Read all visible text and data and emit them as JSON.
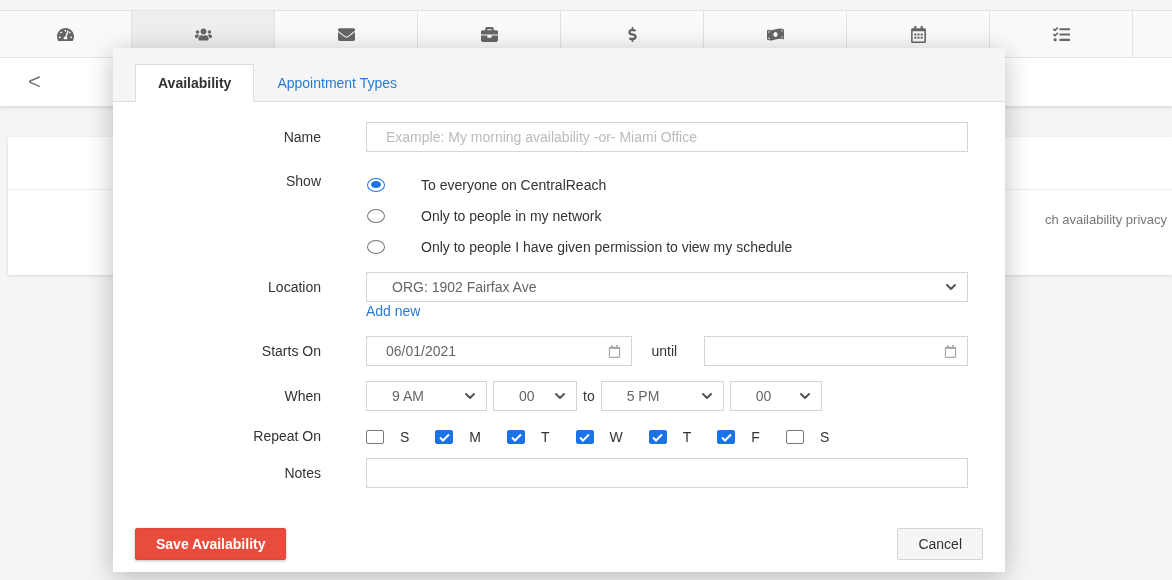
{
  "nav": {
    "items": [
      {
        "selected": false
      },
      {
        "selected": true
      },
      {
        "selected": false
      },
      {
        "selected": false
      },
      {
        "selected": false
      },
      {
        "selected": false
      },
      {
        "selected": false
      },
      {
        "selected": false
      }
    ]
  },
  "back_button": "<",
  "background_card": {
    "text": "ch availability privacy"
  },
  "dialog": {
    "tabs": [
      {
        "label": "Availability",
        "selected": true
      },
      {
        "label": "Appointment Types",
        "selected": false
      }
    ],
    "name": {
      "label": "Name",
      "placeholder": "Example: My morning availability -or- Miami Office"
    },
    "show": {
      "label": "Show",
      "options": [
        {
          "label": "To everyone on CentralReach",
          "selected": true
        },
        {
          "label": "Only to people in my network",
          "selected": false
        },
        {
          "label": "Only to people I have given permission to view my schedule",
          "selected": false
        }
      ]
    },
    "location": {
      "label": "Location",
      "value": "ORG: 1902 Fairfax Ave",
      "link": "Add new"
    },
    "starts_on": {
      "label": "Starts On",
      "value": "06/01/2021",
      "until_label": "until"
    },
    "when": {
      "label": "When",
      "start_hour": "9 AM",
      "start_minute": "00",
      "separator": "to",
      "end_hour": "5 PM",
      "end_minute": "00"
    },
    "repeat_on": {
      "label": "Repeat On",
      "days": [
        {
          "label": "S",
          "checked": false
        },
        {
          "label": "M",
          "checked": true
        },
        {
          "label": "T",
          "checked": true
        },
        {
          "label": "W",
          "checked": true
        },
        {
          "label": "T",
          "checked": true
        },
        {
          "label": "F",
          "checked": true
        },
        {
          "label": "S",
          "checked": false
        }
      ]
    },
    "notes": {
      "label": "Notes"
    },
    "buttons": [
      {
        "label": "Save Availability",
        "kind": "primary"
      },
      {
        "label": "Cancel",
        "kind": "secondary"
      }
    ]
  }
}
